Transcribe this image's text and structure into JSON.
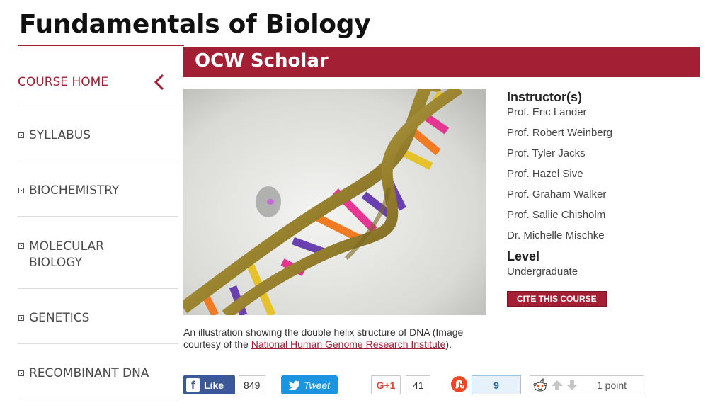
{
  "page": {
    "title": "Fundamentals of Biology"
  },
  "banner": {
    "label": "OCW Scholar"
  },
  "nav": {
    "home": "COURSE HOME",
    "items": [
      {
        "label": "SYLLABUS"
      },
      {
        "label": "BIOCHEMISTRY"
      },
      {
        "label": "MOLECULAR BIOLOGY",
        "line1": "MOLECULAR",
        "line2": "BIOLOGY"
      },
      {
        "label": "GENETICS"
      },
      {
        "label": "RECOMBINANT DNA"
      }
    ]
  },
  "image": {
    "caption_pre": "An illustration showing the double helix structure of DNA (Image courtesy of the ",
    "caption_link": "National Human Genome Research Institute",
    "caption_post": ")."
  },
  "sidebar": {
    "instructors_heading": "Instructor(s)",
    "instructors": [
      "Prof. Eric Lander",
      "Prof. Robert Weinberg",
      "Prof. Tyler Jacks",
      "Prof. Hazel Sive",
      "Prof. Graham Walker",
      "Prof. Sallie Chisholm",
      "Dr. Michelle Mischke"
    ],
    "level_heading": "Level",
    "level_value": "Undergraduate",
    "cite_label": "CITE THIS COURSE"
  },
  "social": {
    "facebook_label": "Like",
    "facebook_count": "849",
    "twitter_label": "Tweet",
    "gplus_label": "G+1",
    "gplus_count": "41",
    "stumble_count": "9",
    "reddit_points": "1 point"
  },
  "colors": {
    "brand": "#a31f34",
    "facebook": "#3b5998",
    "twitter": "#1b95e0"
  }
}
